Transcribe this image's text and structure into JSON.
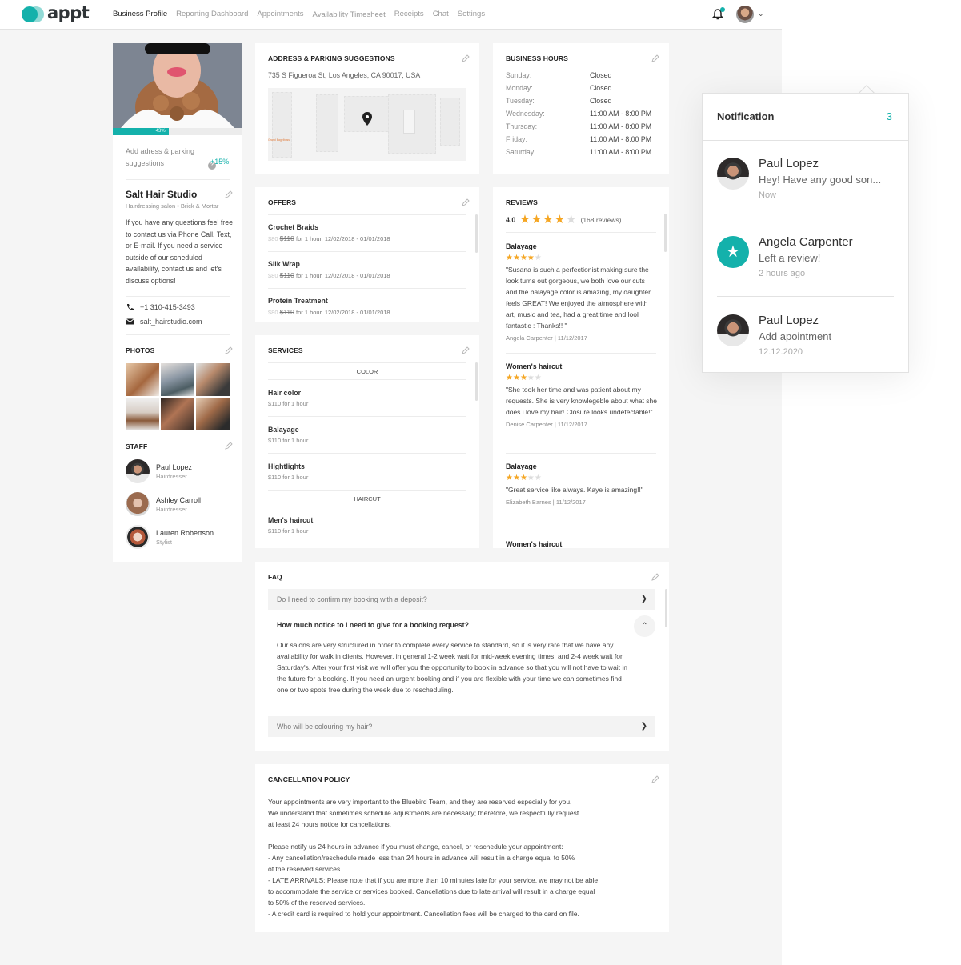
{
  "app": {
    "logo_text": "appt"
  },
  "nav": {
    "items": [
      "Business Profile",
      "Reporting Dashboard",
      "Appointments",
      "Availability Timesheet",
      "Receipts",
      "Chat",
      "Settings"
    ],
    "active": "Business Profile"
  },
  "header": {
    "bell_icon": "bell-icon",
    "has_unread": true
  },
  "profile": {
    "completion_percent": 43,
    "completion_label": "43%",
    "add_address_label": "Add adress & parking suggestions",
    "add_address_bonus": "+15%",
    "name": "Salt Hair Studio",
    "subtitle": "Hairdressing salon • Brick & Mortar",
    "description": "If you have any questions feel free to contact us via Phone Call, Text, or E-mail. If you need a service outside of our scheduled availability, contact us and let's discuss options!",
    "phone": "+1 310-415-3493",
    "website": "salt_hairstudio.com",
    "photos_title": "PHOTOS",
    "staff_title": "STAFF",
    "staff": [
      {
        "name": "Paul Lopez",
        "role": "Hairdresser"
      },
      {
        "name": "Ashley Carroll",
        "role": "Hairdresser"
      },
      {
        "name": "Lauren Robertson",
        "role": "Stylist"
      }
    ]
  },
  "address": {
    "title": "ADDRESS & PARKING SUGGESTIONS",
    "text": "735 S Figueroa St, Los Angeles, CA 90017, USA"
  },
  "hours": {
    "title": "BUSINESS HOURS",
    "rows": [
      {
        "day": "Sunday:",
        "value": "Closed"
      },
      {
        "day": "Monday:",
        "value": "Closed"
      },
      {
        "day": "Tuesday:",
        "value": "Closed"
      },
      {
        "day": "Wednesday:",
        "value": "11:00 AM - 8:00 PM"
      },
      {
        "day": "Thursday:",
        "value": "11:00 AM - 8:00 PM"
      },
      {
        "day": "Friday:",
        "value": "11:00 AM - 8:00 PM"
      },
      {
        "day": "Saturday:",
        "value": "11:00 AM - 8:00 PM"
      }
    ]
  },
  "offers": {
    "title": "OFFERS",
    "items": [
      {
        "name": "Crochet Braids",
        "sale_price": "$80",
        "old_price": "$110",
        "details": "for 1 hour, 12/02/2018 - 01/01/2018"
      },
      {
        "name": "Silk Wrap",
        "sale_price": "$80",
        "old_price": "$110",
        "details": "for 1 hour, 12/02/2018 - 01/01/2018"
      },
      {
        "name": "Protein Treatment",
        "sale_price": "$80",
        "old_price": "$110",
        "details": "for 1 hour, 12/02/2018 - 01/01/2018"
      }
    ]
  },
  "services": {
    "title": "SERVICES",
    "categories": [
      {
        "name": "COLOR",
        "items": [
          {
            "name": "Hair color",
            "price": "$110 for 1 hour"
          },
          {
            "name": "Balayage",
            "price": "$110 for 1 hour"
          },
          {
            "name": "Hightlights",
            "price": "$110 for 1 hour"
          }
        ]
      },
      {
        "name": "HAIRCUT",
        "items": [
          {
            "name": "Men's haircut",
            "price": "$110 for 1 hour"
          }
        ]
      }
    ]
  },
  "reviews": {
    "title": "REVIEWS",
    "average": "4.0",
    "average_stars": 4,
    "count_label": "(168 reviews)",
    "items": [
      {
        "service": "Balayage",
        "stars": 4,
        "text": "\"Susana is such a perfectionist making sure the look turns out gorgeous, we both love our cuts and the balayage color is amazing, my daughter feels GREAT! We enjoyed the atmosphere with art, music and tea, had a great time and lool fantastic : Thanks!! \"",
        "author": "Angela Carpenter | 11/12/2017"
      },
      {
        "service": "Women's haircut",
        "stars": 3,
        "text": "\"She took her time and was patient about my requests. She is very knowlegeble about what she does i love my hair! Closure looks undetectable!\"",
        "author": "Denise Carpenter | 11/12/2017"
      },
      {
        "service": "Balayage",
        "stars": 3,
        "text": "\"Great service like always. Kaye is amazing!!\"",
        "author": "Elizabeth Barnes | 11/12/2017"
      },
      {
        "service": "Women's haircut",
        "stars": 0,
        "text": "",
        "author": ""
      }
    ]
  },
  "faq": {
    "title": "FAQ",
    "items": [
      {
        "question": "Do I need to confirm my booking with a deposit?",
        "expanded": false
      },
      {
        "question": "How much notice to I need to give for a booking request?",
        "expanded": true,
        "answer": "Our salons are very structured in order to complete every service to standard, so it is very rare that we have any availability for walk in clients. However, in general 1-2 week wait for mid-week evening times, and 2-4 week wait for Saturday's. After your first visit we will offer you the opportunity to book in advance so that you will not have to wait in the future for a booking. If you need an urgent booking and if you are flexible with your time we can sometimes find one or two spots free during the week due to rescheduling."
      },
      {
        "question": "Who will be colouring my hair?",
        "expanded": false
      }
    ]
  },
  "cancellation": {
    "title": "CANCELLATION POLICY",
    "text": "Your appointments are very important to the Bluebird Team, and they are reserved especially for you.\nWe understand that sometimes schedule adjustments are necessary; therefore, we respectfully request\nat least 24 hours notice for cancellations.\n\nPlease notify us 24 hours in advance if you must change, cancel, or reschedule your appointment:\n - Any cancellation/reschedule made less than 24 hours in advance will result in a charge equal to 50%\nof the reserved services.\n- LATE ARRIVALS: Please note that if you are more than 10 minutes late for your service, we may not be able\nto accommodate the service or services booked. Cancellations due to late arrival will result in a charge equal\nto 50% of the reserved services.\n- A credit card is required to hold your appointment. Cancellation fees will be charged to the card on file."
  },
  "notifications": {
    "title": "Notification",
    "count": "3",
    "items": [
      {
        "name": "Paul Lopez",
        "message": "Hey! Have any good son...",
        "time": "Now",
        "avatar": "photo"
      },
      {
        "name": "Angela Carpenter",
        "message": "Left a review!",
        "time": "2 hours ago",
        "avatar": "star-icon"
      },
      {
        "name": "Paul Lopez",
        "message": "Add apointment",
        "time": "12.12.2020",
        "avatar": "photo"
      }
    ]
  },
  "colors": {
    "accent": "#14b1ab",
    "star": "#f5a623",
    "background": "#f5f5f5"
  }
}
